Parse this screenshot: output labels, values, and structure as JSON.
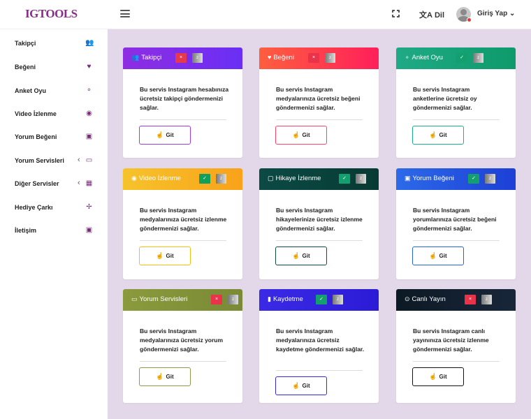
{
  "brand": {
    "logo": "IGTOOLS"
  },
  "topbar": {
    "language_icon": "translate-icon",
    "language_glyph": "文A",
    "language_label": "Dil",
    "user_label": "Giriş Yap",
    "user_chevron": "⌄"
  },
  "sidebar": {
    "items": [
      {
        "label": "Takipçi",
        "icon": "user-plus-icon",
        "glyph": "👥"
      },
      {
        "label": "Beğeni",
        "icon": "heart-icon",
        "glyph": "♥"
      },
      {
        "label": "Anket Oyu",
        "icon": "poll-icon",
        "glyph": "⚬"
      },
      {
        "label": "Video İzlenme",
        "icon": "eye-icon",
        "glyph": "◉"
      },
      {
        "label": "Yorum Beğeni",
        "icon": "comment-heart-icon",
        "glyph": "▣"
      },
      {
        "label": "Yorum Servisleri",
        "icon": "comment-icon",
        "glyph": "▭",
        "chevron": "‹"
      },
      {
        "label": "Diğer Servisler",
        "icon": "grid-icon",
        "glyph": "▦",
        "chevron": "‹"
      },
      {
        "label": "Hediye Çarkı",
        "icon": "pinwheel-icon",
        "glyph": "✢"
      },
      {
        "label": "İletişim",
        "icon": "contact-icon",
        "glyph": "▣"
      }
    ]
  },
  "cards": [
    {
      "title": "Takipçi",
      "icon": "user-plus-icon",
      "glyph": "👥",
      "status": "×",
      "status_color": "#e53950",
      "zlabel": "z",
      "desc": "Bu servis Instagram hesabınıza ücretsiz takipçi göndermenizi sağlar.",
      "button": "Git",
      "button_icon": "hand-pointer-icon",
      "hand_glyph": "☝",
      "header_from": "#8e2de2",
      "header_to": "#6a2ff5",
      "accent": "#9b3de0"
    },
    {
      "title": "Beğeni",
      "icon": "heart-icon",
      "glyph": "♥",
      "status": "×",
      "status_color": "#e8334a",
      "zlabel": "z",
      "desc": "Bu servis Instagram medyalarınıza ücretsiz beğeni göndermenizi sağlar.",
      "button": "Git",
      "button_icon": "hand-pointer-icon",
      "hand_glyph": "☝",
      "header_from": "#fe5f3f",
      "header_to": "#ff1f5a",
      "accent": "#ff4468"
    },
    {
      "title": "Anket Oyu",
      "icon": "poll-icon",
      "glyph": "⚬",
      "status": "✓",
      "status_color": "#13a06e",
      "zlabel": "z",
      "desc": "Bu servis Instagram anketlerine ücretsiz oy göndermenizi sağlar.",
      "button": "Git",
      "button_icon": "hand-pointer-icon",
      "hand_glyph": "☝",
      "header_from": "#1faa86",
      "header_to": "#0e9a6a",
      "accent": "#19b091"
    },
    {
      "title": "Video İzlenme",
      "icon": "eye-icon",
      "glyph": "◉",
      "status": "✓",
      "status_color": "#10a05c",
      "zlabel": "z",
      "desc": "Bu servis Instagram medyalarınıza ücretsiz izlenme göndermenizi sağlar.",
      "button": "Git",
      "button_icon": "hand-pointer-icon",
      "hand_glyph": "☝",
      "header_from": "#f6c32b",
      "header_to": "#f9a21a",
      "accent": "#f2c014"
    },
    {
      "title": "Hikaye İzlenme",
      "icon": "stories-icon",
      "glyph": "▢",
      "status": "✓",
      "status_color": "#13a06e",
      "zlabel": "z",
      "desc": "Bu servis Instagram hikayelerinize ücretsiz izlenme göndermenizi sağlar.",
      "button": "Git",
      "button_icon": "hand-pointer-icon",
      "hand_glyph": "☝",
      "header_from": "#0c4a45",
      "header_to": "#073a33",
      "accent": "#0d4c46"
    },
    {
      "title": "Yorum Beğeni",
      "icon": "comment-heart-icon",
      "glyph": "▣",
      "status": "✓",
      "status_color": "#13a06e",
      "zlabel": "z",
      "desc": "Bu servis Instagram yorumlarınıza ücretsiz beğeni göndermenizi sağlar.",
      "button": "Git",
      "button_icon": "hand-pointer-icon",
      "hand_glyph": "☝",
      "header_from": "#2c6ae8",
      "header_to": "#1d3fd6",
      "accent": "#2266dd"
    },
    {
      "title": "Yorum Servisleri",
      "icon": "comment-icon",
      "glyph": "▭",
      "status": "×",
      "status_color": "#e8334a",
      "zlabel": "z",
      "desc": "Bu servis Instagram medyalarınıza ücretsiz yorum göndermenizi sağlar.",
      "button": "Git",
      "button_icon": "hand-pointer-icon",
      "hand_glyph": "☝",
      "header_from": "#8a9a3c",
      "header_to": "#7a8a36",
      "accent": "#8d9a4a"
    },
    {
      "title": "Kaydetme",
      "icon": "bookmark-icon",
      "glyph": "▮",
      "status": "✓",
      "status_color": "#13a06e",
      "zlabel": "z",
      "desc": "Bu servis Instagram medyalarınıza ücretsiz kaydetme göndermenizi sağlar.",
      "button": "Git",
      "button_icon": "hand-pointer-icon",
      "hand_glyph": "☝",
      "header_from": "#3a2ae6",
      "header_to": "#2c1bd6",
      "accent": "#3328e0"
    },
    {
      "title": "Canlı Yayın",
      "icon": "live-icon",
      "glyph": "⊙",
      "status": "×",
      "status_color": "#e8334a",
      "zlabel": "z",
      "desc": "Bu servis Instagram canlı yayınınıza ücretsiz izlenme göndermenizi sağlar.",
      "button": "Git",
      "button_icon": "hand-pointer-icon",
      "hand_glyph": "☝",
      "header_from": "#0c1a25",
      "header_to": "#18263a",
      "accent": "#111111"
    }
  ]
}
